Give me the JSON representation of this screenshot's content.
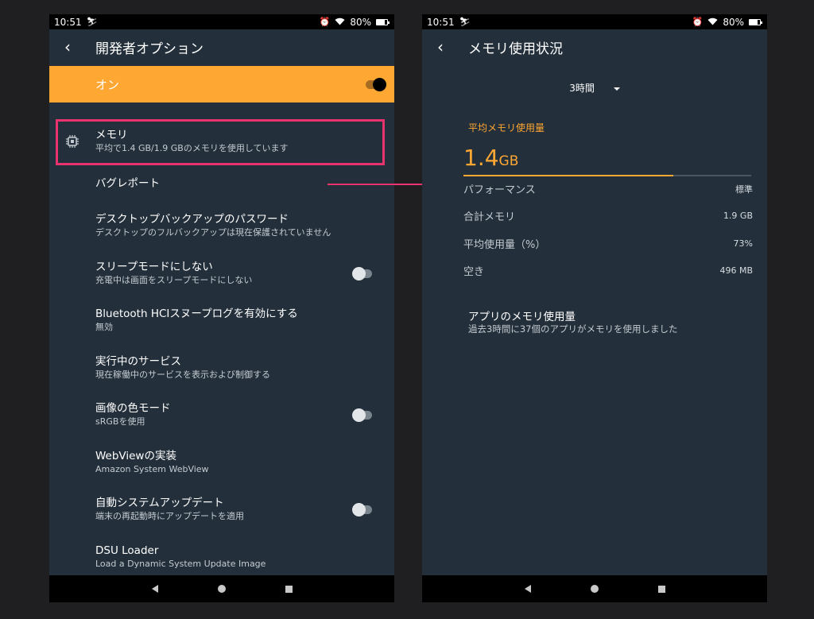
{
  "status_bar": {
    "time": "10:51",
    "battery": "80%"
  },
  "left_screen": {
    "title": "開発者オプション",
    "toggle": {
      "label": "オン",
      "on": true
    },
    "items": [
      {
        "title": "メモリ",
        "subtitle": "平均で1.4 GB/1.9 GBのメモリを使用しています",
        "icon": "chip-icon",
        "highlighted": true
      },
      {
        "title": "バグレポート"
      },
      {
        "title": "デスクトップバックアップのパスワード",
        "subtitle": "デスクトップのフルバックアップは現在保護されていません"
      },
      {
        "title": "スリープモードにしない",
        "subtitle": "充電中は画面をスリープモードにしない",
        "toggle": false
      },
      {
        "title": "Bluetooth HCIスヌープログを有効にする",
        "subtitle": "無効"
      },
      {
        "title": "実行中のサービス",
        "subtitle": "現在稼働中のサービスを表示および制御する"
      },
      {
        "title": "画像の色モード",
        "subtitle": "sRGBを使用",
        "toggle": false
      },
      {
        "title": "WebViewの実装",
        "subtitle": "Amazon System WebView"
      },
      {
        "title": "自動システムアップデート",
        "subtitle": "端末の再起動時にアップデートを適用",
        "toggle": false
      },
      {
        "title": "DSU Loader",
        "subtitle": "Load a Dynamic System Update Image"
      }
    ]
  },
  "right_screen": {
    "title": "メモリ使用状況",
    "time_range": "3時間",
    "avg_label": "平均メモリ使用量",
    "avg_value": "1.4",
    "avg_unit": "GB",
    "usage_fraction": 0.73,
    "stats": [
      {
        "label": "パフォーマンス",
        "value": "標準"
      },
      {
        "label": "合計メモリ",
        "value": "1.9 GB"
      },
      {
        "label": "平均使用量（%）",
        "value": "73%"
      },
      {
        "label": "空き",
        "value": "496 MB"
      }
    ],
    "apps_title": "アプリのメモリ使用量",
    "apps_subtitle": "過去3時間に37個のアプリがメモリを使用しました"
  },
  "colors": {
    "accent": "#ffa733",
    "highlight": "#e8336e",
    "screen_bg": "#232f3a",
    "page_bg": "#1f1f21"
  }
}
